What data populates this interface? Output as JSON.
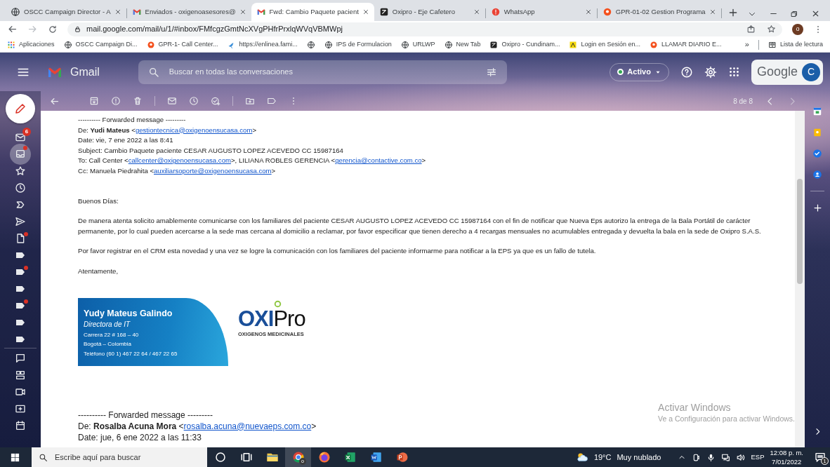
{
  "browser": {
    "tabs": [
      {
        "title": "OSCC Campaign Director - A",
        "kind": "globe",
        "selected": false
      },
      {
        "title": "Enviados - oxigenoasesores@",
        "kind": "m-logo",
        "selected": false
      },
      {
        "title": "Fwd: Cambio Paquete pacient",
        "kind": "m-logo",
        "selected": true
      },
      {
        "title": "Oxipro - Eje Cafetero",
        "kind": "dark-square",
        "selected": false
      },
      {
        "title": "WhatsApp",
        "kind": "alert-dot",
        "selected": false
      },
      {
        "title": "GPR-01-02 Gestion Programa",
        "kind": "pin-dot",
        "selected": false
      }
    ],
    "address": "mail.google.com/mail/u/1/#inbox/FMfcgzGmtNcXVgPHfrPrxlqWVqVBMWpj",
    "profile_initial": "o",
    "bookmarks": [
      {
        "label": "Aplicaciones",
        "kind": "grid-dots"
      },
      {
        "label": "OSCC Campaign Di...",
        "kind": "globe"
      },
      {
        "label": "GPR-1- Call Center...",
        "kind": "pin-dot"
      },
      {
        "label": "https://enlinea.fami...",
        "kind": "bird"
      },
      {
        "kind": "globe"
      },
      {
        "label": "IPS de Formulacion",
        "kind": "globe"
      },
      {
        "label": "URLWP",
        "kind": "globe"
      },
      {
        "label": "New Tab",
        "kind": "globe"
      },
      {
        "label": "Oxipro - Cundinam...",
        "kind": "dark-square"
      },
      {
        "label": "Login en Sesión en...",
        "kind": "note"
      },
      {
        "label": "LLAMAR DIARIO E...",
        "kind": "pin-dot"
      }
    ],
    "bookmarks_more": "»",
    "reading_list": "Lista de lectura"
  },
  "gmail": {
    "brand": "Gmail",
    "search_placeholder": "Buscar en todas las conversaciones",
    "status": {
      "label": "Activo",
      "color": "#34a853"
    },
    "account_brand": "Google",
    "account_initial": "C",
    "counter": "8 de 8",
    "rail": [
      {
        "kind": "envelope",
        "badge": "6",
        "dot": false,
        "selected": false
      },
      {
        "kind": "tray",
        "dot": true,
        "selected": true
      },
      {
        "kind": "star",
        "dot": false,
        "selected": false
      },
      {
        "kind": "clock",
        "dot": false,
        "selected": false
      },
      {
        "kind": "chevron-arrow",
        "dot": false,
        "selected": false
      },
      {
        "kind": "send",
        "dot": false,
        "selected": false
      },
      {
        "kind": "document",
        "dot": true,
        "selected": false
      },
      {
        "kind": "label",
        "dot": false,
        "selected": false
      },
      {
        "kind": "label",
        "dot": true,
        "selected": false
      },
      {
        "kind": "label",
        "dot": false,
        "selected": false
      },
      {
        "kind": "label",
        "dot": true,
        "selected": false
      },
      {
        "kind": "label",
        "dot": false,
        "selected": false
      },
      {
        "kind": "label",
        "dot": false,
        "selected": false
      },
      {
        "kind": "speech-bubble",
        "dot": false,
        "selected": false
      },
      {
        "kind": "grid-tiles",
        "dot": false,
        "selected": false
      },
      {
        "kind": "video-camera",
        "dot": false,
        "selected": false
      },
      {
        "kind": "plus-screen",
        "dot": false,
        "selected": false
      },
      {
        "kind": "calendar",
        "dot": false,
        "selected": false
      }
    ]
  },
  "message": {
    "forward1": {
      "separator": "---------- Forwarded message ---------",
      "lines": [
        [
          {
            "text": "De: **Yudi Mateus** <"
          },
          {
            "link": "gestiontecnica@oxigenoensucasa.com"
          },
          {
            "text": ">"
          }
        ],
        [
          {
            "text": "Date: vie, 7 ene 2022 a las 8:41"
          }
        ],
        [
          {
            "text": "Subject: Cambio Paquete paciente CESAR AUGUSTO LOPEZ ACEVEDO CC 15987164"
          }
        ],
        [
          {
            "text": "To: Call Center <"
          },
          {
            "link": "callcenter@oxigenoensucasa.com"
          },
          {
            "text": ">, LILIANA ROBLES GERENCIA <"
          },
          {
            "link": "gerencia@contactive.com.co"
          },
          {
            "text": ">"
          }
        ],
        [
          {
            "text": "Cc: Manuela Piedrahita <"
          },
          {
            "link": "auxiliarsoporte@oxigenoensucasa.com"
          },
          {
            "text": ">"
          }
        ]
      ]
    },
    "greeting": "Buenos Días:",
    "paragraphs": [
      "De manera atenta solicito amablemente comunicarse con los familiares del paciente CESAR AUGUSTO LOPEZ ACEVEDO CC 15987164 con el fin de notificar que Nueva Eps autorizo la entrega de la Bala Portátil de carácter permanente, por lo cual pueden acercarse a la sede mas cercana al domicilio a reclamar, por favor especificar que tienen derecho a 4 recargas mensuales no acumulables entregada y devuelta la bala en la sede de Oxipro S.A.S.",
      "Por favor registrar en el CRM esta novedad y una vez se logre la comunicación con los familiares del paciente informarme para notificar a la EPS ya que es un fallo de tutela."
    ],
    "closing": "Atentamente,",
    "signature": {
      "name": "Yudy Mateus Galindo",
      "role": "Directora de IT",
      "lines": [
        "Carrera 22 # 168 – 40",
        "Bogotá – Colombia",
        "Teléfono (60 1) 467 22 64 / 467 22 65"
      ],
      "logo_parts": [
        "OXI",
        "Pro"
      ],
      "tagline": "OXIGENOS MEDICINALES"
    },
    "forward2": {
      "separator": "---------- Forwarded message ---------",
      "lines": [
        [
          {
            "text": "De: **Rosalba Acuna Mora** <"
          },
          {
            "link": "rosalba.acuna@nuevaeps.com.co"
          },
          {
            "text": ">"
          }
        ],
        [
          {
            "text": "Date: jue, 6 ene 2022 a las 11:33"
          }
        ]
      ]
    }
  },
  "windows_notice": {
    "title": "Activar Windows",
    "hint": "Ve a Configuración para activar Windows."
  },
  "taskbar": {
    "search_placeholder": "Escribe aquí para buscar",
    "apps": [
      {
        "kind": "circle",
        "selected": false
      },
      {
        "kind": "task-view",
        "selected": false
      },
      {
        "kind": "folder",
        "selected": false
      },
      {
        "kind": "ring",
        "selected": true,
        "badge": "o"
      },
      {
        "kind": "flame",
        "selected": false
      },
      {
        "kind": "spreadsheet",
        "selected": false
      },
      {
        "kind": "document-blue",
        "selected": false
      },
      {
        "kind": "presentation",
        "selected": false
      }
    ],
    "temperature": "19°C",
    "weather": "Muy nublado",
    "language": "ESP",
    "time": "12:08 p. m.",
    "date": "7/01/2022",
    "notifications": "1"
  }
}
